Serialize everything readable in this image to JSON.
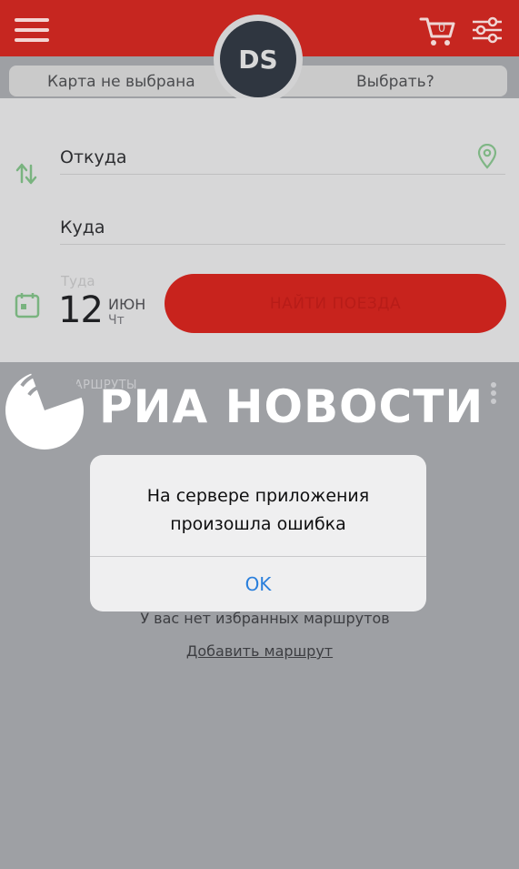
{
  "header": {
    "menu_icon": "hamburger-icon",
    "cart_icon": "cart-icon",
    "cart_count": "0",
    "filter_icon": "sliders-icon",
    "brand_color": "#c62620"
  },
  "profile": {
    "avatar_initials": "DS"
  },
  "card_bar": {
    "status_text": "Карта не выбрана",
    "action_text": "Выбрать?"
  },
  "search_form": {
    "swap_icon": "swap-arrows-icon",
    "from_label": "Откуда",
    "location_icon": "location-pin-icon",
    "to_label": "Куда",
    "calendar_icon": "calendar-icon",
    "direction_label": "Туда",
    "date_day": "12",
    "date_month": "ИЮН",
    "date_weekday": "Чт",
    "find_button": "НАЙТИ ПОЕЗДА"
  },
  "routes": {
    "tab_label": "МАРШРУТЫ",
    "empty_text": "У вас нет избранных маршрутов",
    "add_link": "Добавить маршрут"
  },
  "watermark": {
    "text": "РИА НОВОСТИ"
  },
  "alert": {
    "message_line1": "На сервере приложения",
    "message_line2": "произошла ошибка",
    "ok_button": "OK",
    "ok_color": "#2a7fdc"
  }
}
